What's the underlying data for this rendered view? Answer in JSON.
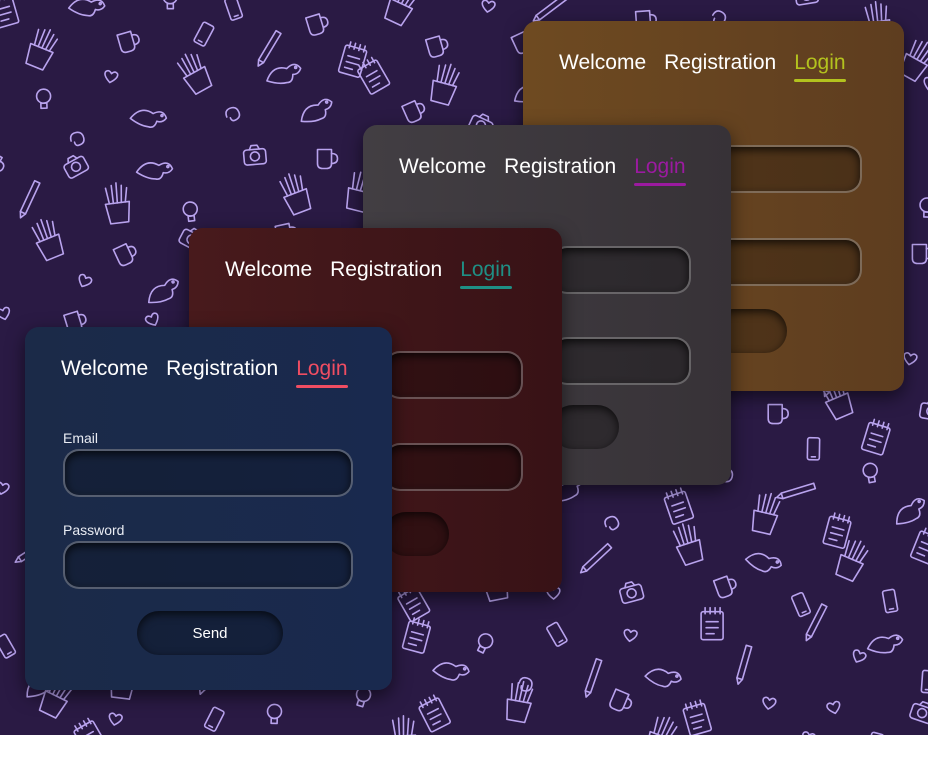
{
  "colors": {
    "background": "#2a1a44",
    "doodle_stroke": "#b9a3ee",
    "card_gold": "#6a4520",
    "card_gray": "#3f3a3f",
    "card_maroon": "#3d1418",
    "card_navy": "#1a2a4a",
    "accent_gold": "#b3c21e",
    "accent_gray": "#9b1aa0",
    "accent_maroon": "#1f8f85",
    "accent_navy": "#f04d62"
  },
  "cards": [
    {
      "tabs": {
        "welcome": "Welcome",
        "registration": "Registration",
        "login": "Login"
      }
    },
    {
      "tabs": {
        "welcome": "Welcome",
        "registration": "Registration",
        "login": "Login"
      }
    },
    {
      "tabs": {
        "welcome": "Welcome",
        "registration": "Registration",
        "login": "Login"
      }
    },
    {
      "tabs": {
        "welcome": "Welcome",
        "registration": "Registration",
        "login": "Login"
      },
      "form": {
        "email_label": "Email",
        "email_value": "",
        "password_label": "Password",
        "password_value": "",
        "send_label": "Send"
      }
    }
  ]
}
